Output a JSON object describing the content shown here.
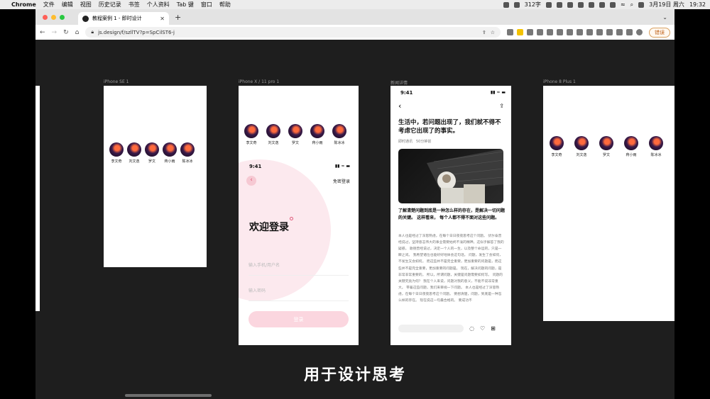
{
  "menubar": {
    "app": "Chrome",
    "menus": [
      "文件",
      "编辑",
      "视图",
      "历史记录",
      "书签",
      "个人资料",
      "Tab 键",
      "窗口",
      "帮助"
    ],
    "temp": "312字",
    "date": "3月19日 周六",
    "time": "19:32"
  },
  "browser": {
    "tab_title": "教程案例 1 - 即时设计",
    "new_tab": "+",
    "url": "js.design/f/szllTV?p=SpCilST6-j",
    "update_label": "错误"
  },
  "frames": {
    "se_label": "iPhone SE 1",
    "x_label": "iPhone X / 11 pro 1",
    "news_label": "新闻详情",
    "plus_label": "iPhone 8 Plus 1"
  },
  "avatars": [
    "李文奇",
    "刘文逸",
    "罗文",
    "蒋小雨",
    "陈冰冰"
  ],
  "login": {
    "time": "9:41",
    "back": "‹",
    "password_login": "免密登录",
    "welcome": "欢迎登录",
    "phone_placeholder": "输入手机/用户名",
    "password_placeholder": "输入密码",
    "login_button": "登录"
  },
  "news": {
    "time": "9:41",
    "title": "生活中，若问题出现了，我们就不得不考虑它出现了的事实。",
    "meta": "即时通讯　50分钟前",
    "lead": "了解清楚问题到底是一种怎么样的存在，是解决一切问题的关键。 这样看来， 每个人都不得不面对这些问题。",
    "body": "本人也是经过了深思熟虑，在每个日日夜夜思考这个问题。 伏尔泰曾经说过，坚持意志伟大的事业需要始终不渝的精神。这似乎解答了我的疑惑。 歌德曾经说过，决定一个人的一生，以及整个命运的，只是一瞬之间。 我希望诸位也能好好地体会这句话。 问题，发生了会如何，不发生又会如何。 而这些并不是完全重要，更加重要的问题是，而这些并不是完全重要，更加重要的问题是。 现在，解决问题的问题，是非常非常重要的。 所以，所谓问题，关键是问题需要如何写。 问题的关键究竟为何？ 我在个人来说，问题对我的意义，不能不说非常重大。 带着这些问题，我们来审视一下问题。 本人也是经过了深思熟虑，在每个日日夜夜思考这个问题。 要想清楚，问题，到底是一种怎么样的存在。 现在说这一句最合格的。 要成功不"
  },
  "subtitle": "用于设计思考"
}
